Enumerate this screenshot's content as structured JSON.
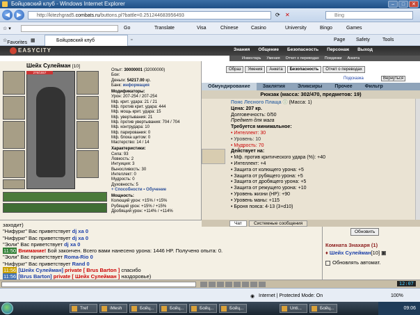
{
  "window": {
    "title": "Бойцовский клуб - Windows Internet Explorer"
  },
  "address": {
    "url_prefix": "http://kitezhgrad5.",
    "url_domain": "combats.ru",
    "url_suffix": "/buttons.pl?battle=0.251244683956493",
    "search_placeholder": "Bing"
  },
  "toolbar": {
    "go": "Go",
    "translate": "Translate",
    "visa": "Visa",
    "chinese": "Chinese",
    "casino": "Casino",
    "university": "University",
    "bingo": "Bingo",
    "games": "Games"
  },
  "favorites_bar": {
    "favorites": "Favorites",
    "tab_label": "Бойцовский клуб",
    "page": "Page",
    "safety": "Safety",
    "tools": "Tools"
  },
  "game_header": {
    "logo": "EASYCITY",
    "nav": [
      "Знания",
      "Общение",
      "Безопасность",
      "Персонаж",
      "Выход"
    ],
    "subnav": [
      "Инвентарь",
      "Умения",
      "Отчет о переводах",
      "Поединки",
      "Анкета"
    ]
  },
  "character": {
    "name": "Шейх Сулейман",
    "level": "[10]",
    "hp": "276/1557",
    "exp_label": "Опыт:",
    "exp": "30000001",
    "exp_next": "(32000000)",
    "battles_label": "Бои:",
    "money_label": "Деньги:",
    "money": "54217.00",
    "bank_label": "Банк:",
    "bank": "информация",
    "modifiers_title": "Модификаторы:",
    "modifiers": [
      "Урон: 207-254 / 207-254",
      "Мф. крит. удара: 21 / 21",
      "Мф. против крит. удара: 444",
      "Мф. мощь крит. удара: 15",
      "Мф. увертывания: 21",
      "Мф. против увертывания: 704 / 704",
      "Мф. контрудара: 10",
      "Мф. парирования: 0",
      "Мф. блока щитом: 0",
      "Мастерство: 14 / 14"
    ],
    "attributes_title": "Характеристики:",
    "attributes": [
      "Сила: 93",
      "Ловкость: 2",
      "Интуиция: 3",
      "Выносливость: 30",
      "Интеллект: 0",
      "Мудрость: 0",
      "Духовность: 5"
    ],
    "abilities_link": "+ Способности • Обучение",
    "powers_title": "Мощность:",
    "powers": [
      "Колющий урон: +15% / +15%",
      "Рубящий урон: +15% / +15%",
      "Дробящий урон: +114% / +114%"
    ]
  },
  "right_buttons": [
    "Образ",
    "Умения",
    "Анкета",
    "Безопасность",
    "Отчет о переводах"
  ],
  "right_links": {
    "hint": "Подсказка",
    "back": "Вернуться"
  },
  "shop_tabs": [
    "Обмундирование",
    "Заклятия",
    "Эликсиры",
    "Прочее",
    "Фильтр"
  ],
  "backpack": "Рюкзак (масса: 302/470, предметов: 19)",
  "item": {
    "name": "Пояс Лесного Плаща",
    "mass": "(Масса: 1)",
    "price": "Цена: 207 кр.",
    "durability": "Долговечность: 0/50",
    "purpose": "Предмет для мага",
    "req_title": "Требуется минимальное:",
    "reqs": [
      "Интеллект: 30",
      "Уровень: 10",
      "Мудрость: 70"
    ],
    "effects_title": "Действует на:",
    "effects": [
      "Мф. против критического удара (%): +40",
      "Интеллект: +4",
      "Защита от колющего урона: +5",
      "Защита от рубящего урона: +5",
      "Защита от дробящего урона: +5",
      "Защита от режущего урона: +10",
      "Уровень жизни (HP): +90",
      "Уровень маны: +115",
      "Броня пояса: 4-13 (3+d10)"
    ]
  },
  "chat_tabs": [
    "Чат",
    "Системные сообщения"
  ],
  "chat": [
    {
      "ts": "",
      "text": "заходит)"
    },
    {
      "ts": "",
      "pre": "\"Нифуркг\" Вас приветствует ",
      "name": "dj xa 0"
    },
    {
      "ts": "",
      "pre": "\"Нифуркг\" Вас приветствует ",
      "name": "dj xa 0"
    },
    {
      "ts": "",
      "pre": "\"Эоли\" Вас приветствует ",
      "name": "dj xa 0"
    },
    {
      "ts": "11:50",
      "alert": "Внимание!",
      "text": " Бой закончен. Всего вами нанесено урона: 1446 HP. Получено опыта: 0."
    },
    {
      "ts": "",
      "pre": "\"Эоли\" Вас приветствует ",
      "name": "Roma-Rio 0"
    },
    {
      "ts": "",
      "pre": "\"Нифуркг\" Вас приветствует ",
      "name": "Rand 0"
    },
    {
      "ts": "11:56",
      "from": "[Шейх Сулейман]",
      "priv": " private [ Brus Barton ]",
      "text": " спасибо"
    },
    {
      "ts": "11:56",
      "from": "[Brus Barton]",
      "priv": " private [ Шейх Сулейман ]",
      "text": " наздоровье)"
    }
  ],
  "sidebar": {
    "refresh": "Обновить",
    "room": "Комната Знахаря (1)",
    "user": "Шейх Сулейман",
    "user_level": "[10]",
    "auto_update": "Обновлять автомат."
  },
  "clock": "12:07",
  "status": {
    "zone": "Internet | Protected Mode: On",
    "zoom": "100%"
  },
  "taskbar": {
    "items": [
      "Tref",
      "iMesh",
      "Бойц...",
      "Бойц...",
      "Бойц...",
      "Бойц...",
      "Unti...",
      "Бойц..."
    ],
    "time": "09:06"
  }
}
